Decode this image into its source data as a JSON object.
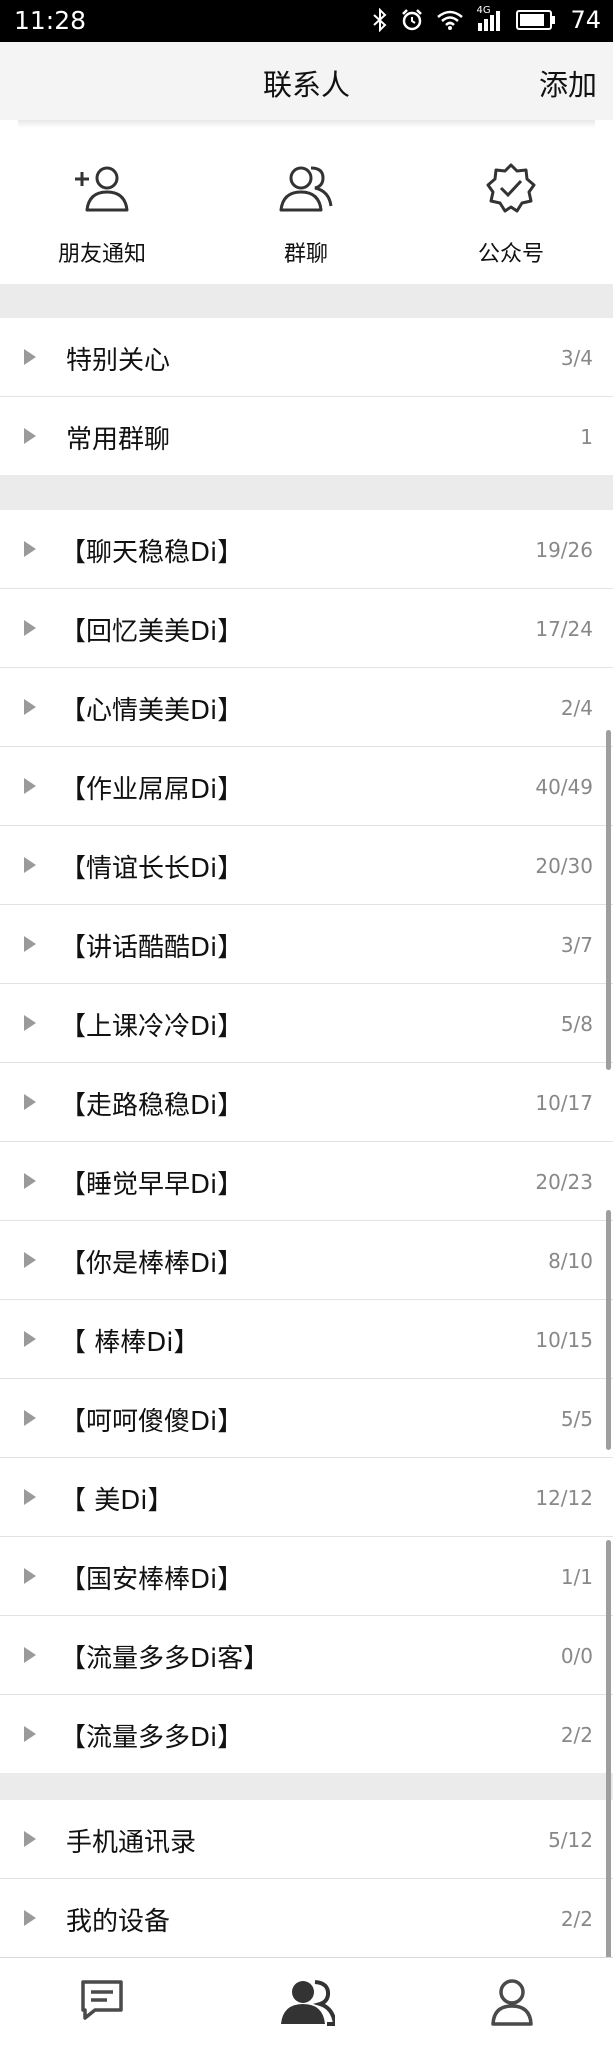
{
  "status_bar": {
    "time": "11:28",
    "signal_label": "4G",
    "battery": "74",
    "icons": [
      "bluetooth-icon",
      "alarm-icon",
      "wifi-icon",
      "signal-icon",
      "battery-icon"
    ]
  },
  "header": {
    "title": "联系人",
    "add_label": "添加"
  },
  "quick_actions": [
    {
      "label": "朋友通知",
      "icon": "add-friend-icon"
    },
    {
      "label": "群聊",
      "icon": "group-icon"
    },
    {
      "label": "公众号",
      "icon": "official-account-badge-icon"
    }
  ],
  "special_groups": [
    {
      "label": "特别关心",
      "count": "3/4"
    },
    {
      "label": "常用群聊",
      "count": "1"
    }
  ],
  "friend_groups": [
    {
      "label": "【聊天稳稳Di】",
      "count": "19/26"
    },
    {
      "label": "【回忆美美Di】",
      "count": "17/24"
    },
    {
      "label": "【心情美美Di】",
      "count": "2/4"
    },
    {
      "label": "【作业屌屌Di】",
      "count": "40/49"
    },
    {
      "label": "【情谊长长Di】",
      "count": "20/30"
    },
    {
      "label": "【讲话酷酷Di】",
      "count": "3/7"
    },
    {
      "label": "【上课冷冷Di】",
      "count": "5/8"
    },
    {
      "label": "【走路稳稳Di】",
      "count": "10/17"
    },
    {
      "label": "【睡觉早早Di】",
      "count": "20/23"
    },
    {
      "label": "【你是棒棒Di】",
      "count": "8/10"
    },
    {
      "label": "【 棒棒Di】",
      "count": "10/15"
    },
    {
      "label": "【呵呵傻傻Di】",
      "count": "5/5"
    },
    {
      "label": "【 美Di】",
      "count": "12/12"
    },
    {
      "label": "【国安棒棒Di】",
      "count": "1/1"
    },
    {
      "label": "【流量多多Di客】",
      "count": "0/0"
    },
    {
      "label": "【流量多多Di】",
      "count": "2/2"
    }
  ],
  "other_groups": [
    {
      "label": "手机通讯录",
      "count": "5/12"
    },
    {
      "label": "我的设备",
      "count": "2/2"
    }
  ],
  "tab_bar": [
    {
      "icon": "message-icon",
      "active": false
    },
    {
      "icon": "contacts-icon",
      "active": true
    },
    {
      "icon": "profile-icon",
      "active": false
    }
  ],
  "colors": {
    "active_tab": "#333333",
    "inactive_tab": "#4a4a4a",
    "count_text": "#888888",
    "divider": "#e2e2e2"
  }
}
